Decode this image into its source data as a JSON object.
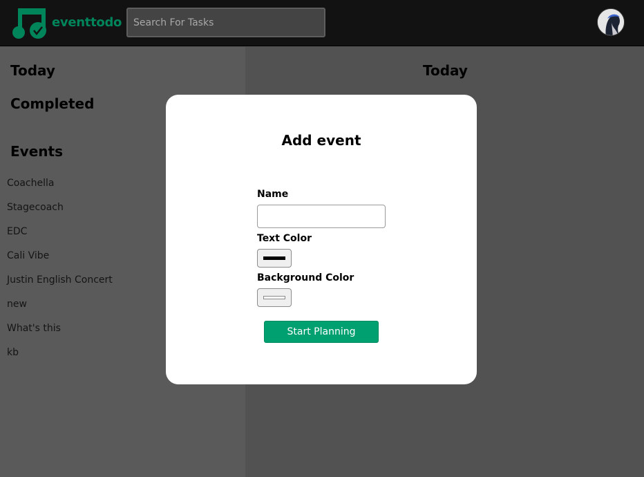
{
  "header": {
    "brand": "eventtodo",
    "logo_icon": "music-note-check-icon",
    "search_placeholder": "Search For Tasks",
    "avatar_icon": "user-avatar"
  },
  "sidebar": {
    "today": "Today",
    "completed": "Completed",
    "events_heading": "Events",
    "events": [
      "Coachella",
      "Stagecoach",
      "EDC",
      "Cali Vibe",
      "Justin English Concert",
      "new",
      "What's this",
      "kb"
    ]
  },
  "main": {
    "title": "Today"
  },
  "modal": {
    "title": "Add event",
    "name_label": "Name",
    "name_value": "",
    "text_color_label": "Text Color",
    "text_color_value": "#000000",
    "background_color_label": "Background Color",
    "background_color_value": "#ffffff",
    "submit_label": "Start Planning"
  },
  "colors": {
    "accent": "#00a070",
    "brand": "#00855a"
  }
}
